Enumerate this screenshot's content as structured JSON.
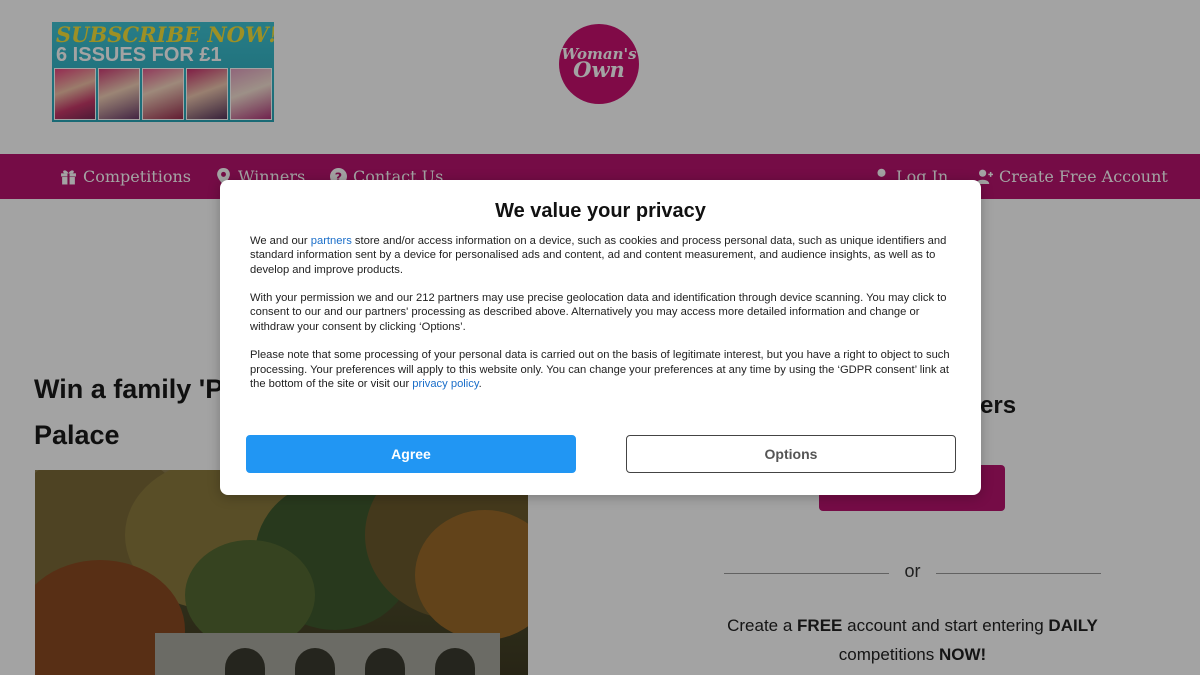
{
  "promo_banner": {
    "line1": "SUBSCRIBE NOW!",
    "line2": "6 ISSUES FOR £1"
  },
  "logo": {
    "line1": "Woman's",
    "line2": "Own"
  },
  "nav": {
    "competitions": "Competitions",
    "winners": "Winners",
    "contact": "Contact Us",
    "login": "Log In",
    "create_account": "Create Free Account"
  },
  "article": {
    "title_line1": "Win a family 'P",
    "title_line2": "Palace"
  },
  "sidebar": {
    "heading_fragment": "ers",
    "or_text": "or",
    "promo_parts": [
      "Create a ",
      "FREE",
      " account and start entering ",
      "DAILY",
      " competitions ",
      "NOW!"
    ]
  },
  "consent": {
    "title": "We value your privacy",
    "p1_before": "We and our ",
    "p1_link": "partners",
    "p1_after": " store and/or access information on a device, such as cookies and process personal data, such as unique identifiers and standard information sent by a device for personalised ads and content, ad and content measurement, and audience insights, as well as to develop and improve products.",
    "p2": "With your permission we and our 212 partners may use precise geolocation data and identification through device scanning. You may click to consent to our and our partners' processing as described above. Alternatively you may access more detailed information and change or withdraw your consent by clicking ‘Options’.",
    "p3_before": "Please note that some processing of your personal data is carried out on the basis of legitimate interest, but you have a right to object to such processing. Your preferences will apply to this website only. You can change your preferences at any time by using the ‘GDPR consent’ link at the bottom of the site or visit our ",
    "p3_link": "privacy policy",
    "p3_after": ".",
    "agree_label": "Agree",
    "options_label": "Options"
  },
  "colors": {
    "brand_magenta": "#b7146e",
    "agree_blue": "#2196f3",
    "link_blue": "#1a6ec9"
  },
  "icons": [
    "gift-icon",
    "map-pin-icon",
    "question-circle-icon",
    "user-icon",
    "user-plus-icon"
  ]
}
